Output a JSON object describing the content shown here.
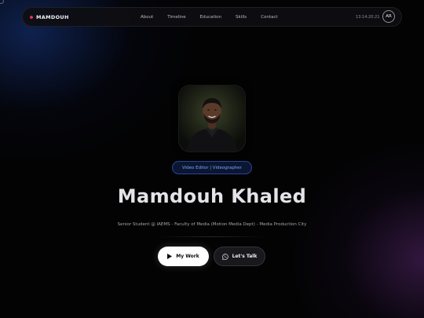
{
  "navbar": {
    "brand": "MAMDOUH",
    "links": [
      "About",
      "Timeline",
      "Education",
      "Skills",
      "Contact"
    ],
    "time": "13:14:20:21",
    "lang": "AR"
  },
  "hero": {
    "role": "Video Editor | Videographer",
    "name": "Mamdouh Khaled",
    "subtitle": "Senior Student @ IAEMS - Faculty of Media (Motion Media Dept) - Media Production City",
    "buttons": {
      "work": "My Work",
      "talk": "Let's Talk"
    }
  },
  "colors": {
    "background": "#030304",
    "brand_dot": "#d6365a",
    "badge_text": "#7ea6f2",
    "primary_button": "#ffffff"
  },
  "icons": {
    "brand": "dot-icon",
    "work_button": "play-icon",
    "talk_button": "whatsapp-icon"
  }
}
